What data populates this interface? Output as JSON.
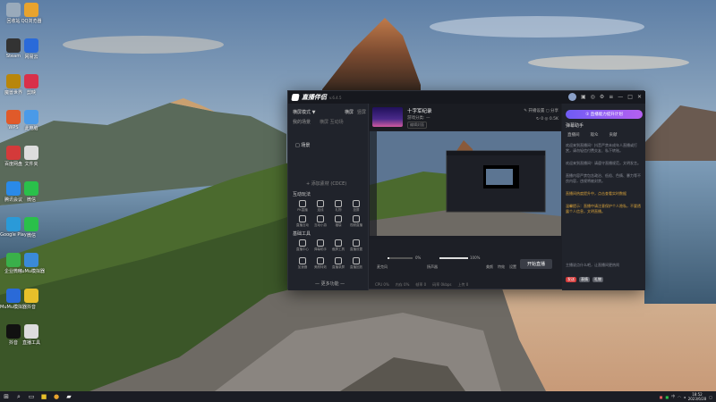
{
  "desktop": {
    "icons": [
      {
        "label": "回收站",
        "icon": "recycle-bin-icon",
        "color": "#9ab"
      },
      {
        "label": "QQ浏览器",
        "icon": "browser-icon",
        "color": "#e8a32e"
      },
      {
        "label": "Steam",
        "icon": "steam-icon",
        "color": "#333"
      },
      {
        "label": "网易云",
        "icon": "doc-icon",
        "color": "#2a6ad9"
      },
      {
        "label": "魔兽世界",
        "icon": "game-icon",
        "color": "#b8860b"
      },
      {
        "label": "剪映",
        "icon": "video-edit-icon",
        "color": "#d9304a"
      },
      {
        "label": "WPS",
        "icon": "office-icon",
        "color": "#e05a2a"
      },
      {
        "label": "此电脑",
        "icon": "computer-icon",
        "color": "#4a9ae8"
      },
      {
        "label": "百度网盘",
        "icon": "cloud-icon",
        "color": "#d43a3a"
      },
      {
        "label": "文件夹",
        "icon": "folder-icon",
        "color": "#ddd"
      },
      {
        "label": "腾讯会议",
        "icon": "meeting-icon",
        "color": "#2a8ae8"
      },
      {
        "label": "微信",
        "icon": "wechat-icon",
        "color": "#2ac04a"
      },
      {
        "label": "Google Play",
        "icon": "play-icon",
        "color": "#2a9ad8"
      },
      {
        "label": "微信",
        "icon": "chat-icon",
        "color": "#2ac04a"
      },
      {
        "label": "企业微信",
        "icon": "work-chat-icon",
        "color": "#3ab04a"
      },
      {
        "label": "MuMu模拟器",
        "icon": "emulator-icon",
        "color": "#3a8ad8"
      },
      {
        "label": "MuMu模拟器",
        "icon": "emulator2-icon",
        "color": "#2a6ad8"
      },
      {
        "label": "抖音",
        "icon": "app-icon",
        "color": "#e8c02a"
      },
      {
        "label": "抖音",
        "icon": "tiktok-icon",
        "color": "#111"
      },
      {
        "label": "直播工具",
        "icon": "tool-icon",
        "color": "#ddd"
      }
    ]
  },
  "app": {
    "name": "直播伴侣",
    "version": "v.6.4.5",
    "left": {
      "mode_label": "横屏模式 ▼",
      "tabs": [
        "横屏",
        "竖屏"
      ],
      "scene_label": "我的场景",
      "scene_tabs": "横屏  互动场",
      "scene_item": "□  场景",
      "add_source": "+ 添加素材 (CDCE)",
      "interact_label": "互动玩法",
      "interact_tools": [
        "PK直播",
        "连线",
        "礼物",
        "投屏"
      ],
      "interact_tools2": [
        "直播互动",
        "互动小游",
        "福袋",
        "视频直播"
      ],
      "basic_label": "基础工具",
      "basic_tools": [
        "直播中心",
        "弹幕助手",
        "截屏工具",
        "直播设置"
      ],
      "basic_tools2": [
        "加速器",
        "美颜特效",
        "直播录屏",
        "直播回放"
      ],
      "more": "— 更多功能 —"
    },
    "center": {
      "title": "十字军纪录",
      "category": "游戏分类: —",
      "tag": "编辑封面",
      "head_right1": "✎ 开播设置   ◻ 分享",
      "head_right2": "↻ 0   ◎ 0.5K",
      "mic_label": "麦克风",
      "mic_value": "0%",
      "speaker_label": "扬声器",
      "speaker_value": "100%",
      "controls": [
        "美颜",
        "特效",
        "设置"
      ],
      "start_button": "开始直播",
      "footer": [
        "CPU 0%",
        "内存 0%",
        "帧率 0",
        "码率 0kbps",
        "上传 0"
      ],
      "mic_level": 0.06,
      "speaker_level": 1.0
    },
    "right": {
      "banner": "① 直播能力提升计划",
      "header": "弹幕助手",
      "tabs": [
        "直播间",
        "观众",
        "贡献"
      ],
      "messages": [
        "欢迎来到直播间！抖音严禁未成年人直播或打赏，请勿轻信付费交友、私下转账。",
        "欢迎来到直播间！请遵守直播规范，文明发言。",
        "直播内容严禁包含政治、低俗、色情、暴力等不良内容，违规将被封禁。"
      ],
      "notices": [
        "直播间热度提升中，点击查看实时数据",
        "温馨提示：直播中请注意保护个人隐私，不要透露个人信息，文明直播。"
      ],
      "input_placeholder": "主播说点什么吧，让直播间更热闹",
      "chips": [
        "发送",
        "表情",
        "礼物"
      ]
    }
  },
  "taskbar": {
    "time": "18:52",
    "date": "2023/6/28",
    "tray_icons": [
      "ime-icon",
      "network-icon",
      "volume-icon",
      "battery-icon"
    ]
  }
}
